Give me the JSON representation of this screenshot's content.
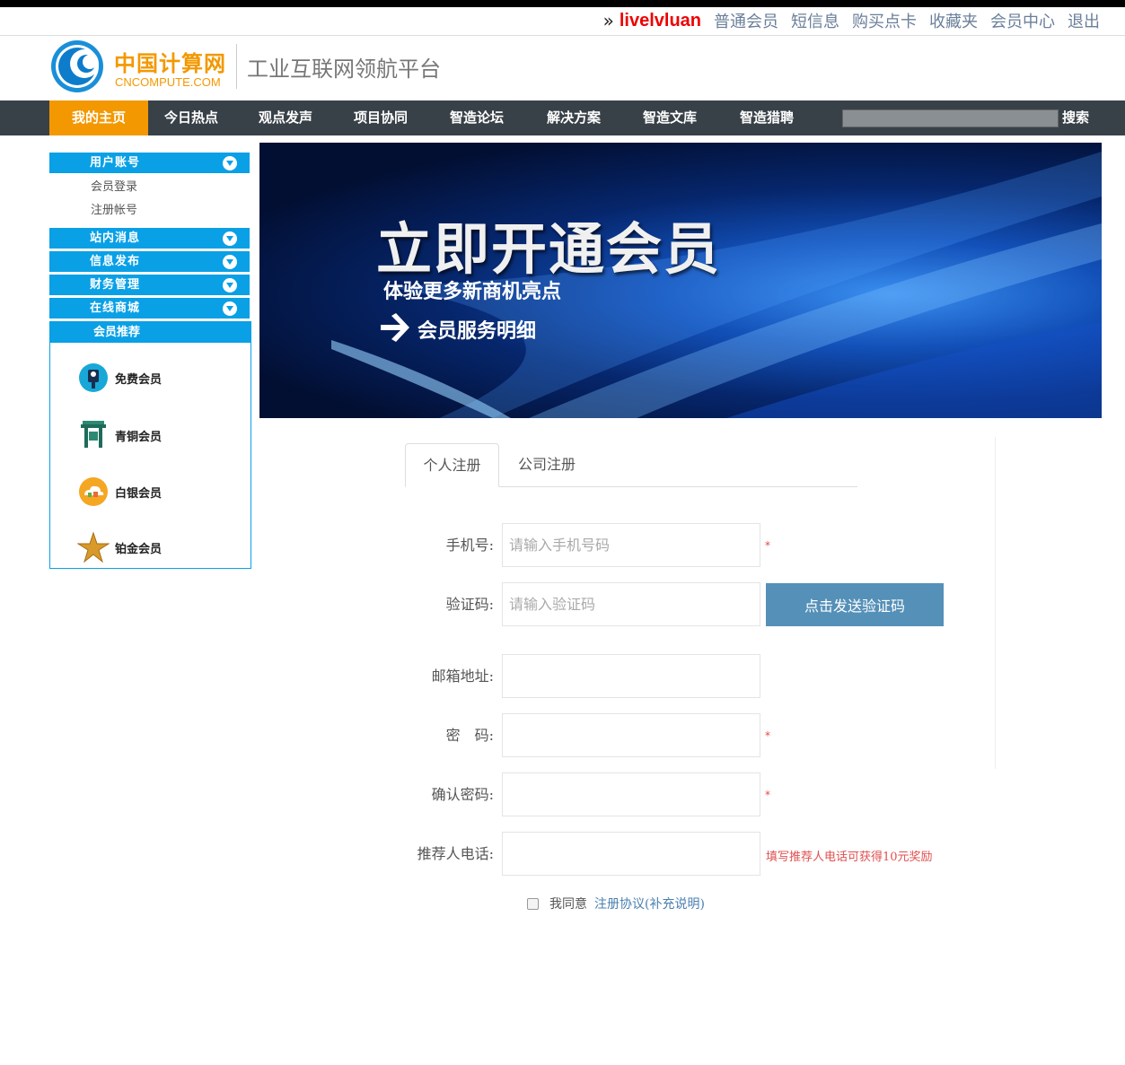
{
  "topbar": {
    "raquo": "»",
    "username": "livelvluan",
    "links": [
      "普通会员",
      "短信息",
      "购买点卡",
      "收藏夹",
      "会员中心",
      "退出"
    ]
  },
  "header": {
    "brand_cn": "中国计算网",
    "brand_en": "CNCOMPUTE.COM",
    "slogan": "工业互联网领航平台"
  },
  "nav": {
    "items": [
      "我的主页",
      "今日热点",
      "观点发声",
      "项目协同",
      "智造论坛",
      "解决方案",
      "智造文库",
      "智造猎聘"
    ],
    "search_label": "搜索"
  },
  "sidebar": {
    "account": "用户账号",
    "login": "会员登录",
    "register": "注册帐号",
    "messages": "站内消息",
    "publish": "信息发布",
    "finance": "财务管理",
    "mall": "在线商城",
    "recommend": "会员推荐",
    "members": [
      "免费会员",
      "青铜会员",
      "白银会员",
      "铂金会员"
    ]
  },
  "banner": {
    "headline": "立即开通会员",
    "sub1": "体验更多新商机亮点",
    "sub2": "会员服务明细"
  },
  "tabs": {
    "personal": "个人注册",
    "company": "公司注册"
  },
  "form": {
    "phone_label": "手机号:",
    "phone_placeholder": "请输入手机号码",
    "code_label": "验证码:",
    "code_placeholder": "请输入验证码",
    "send_code": "点击发送验证码",
    "email_label": "邮箱地址:",
    "password_label": "密　码:",
    "confirm_label": "确认密码:",
    "referrer_label": "推荐人电话:",
    "referrer_hint": "填写推荐人电话可获得10元奖励",
    "required_mark": "*",
    "agree_text": "我同意",
    "agree_link": "注册协议(补充说明)"
  }
}
